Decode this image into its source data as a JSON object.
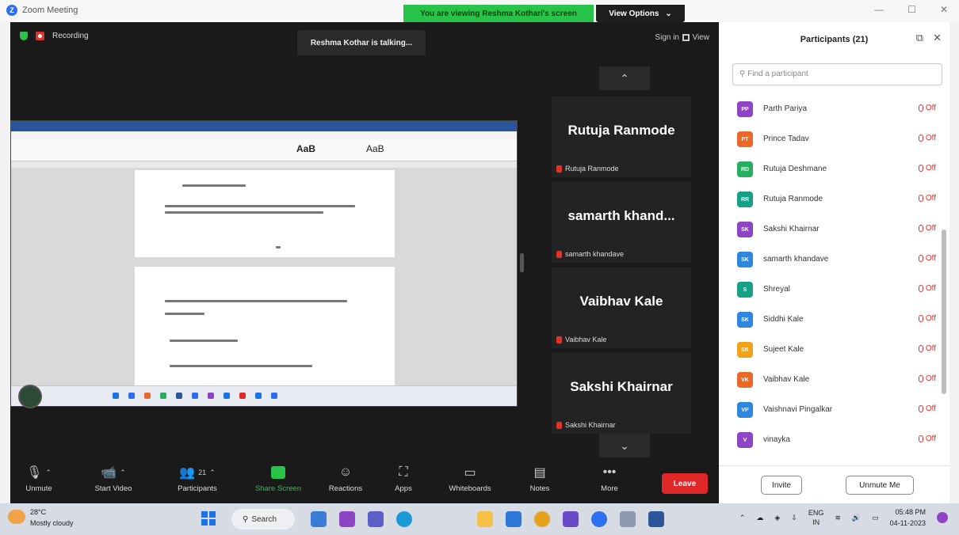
{
  "window": {
    "app_title": "Zoom Meeting",
    "viewing_banner": "You are viewing Reshma Kothari's screen",
    "view_options": "View Options",
    "view_options_caret": "⌄",
    "minimize": "—",
    "maximize": "☐",
    "close": "✕"
  },
  "meeting": {
    "recording": "Recording",
    "talking": "Reshma Kothar is talking...",
    "sign_in": "Sign in",
    "view": "View"
  },
  "shared_screen": {
    "ribbon_style1": "AaB",
    "ribbon_style2": "AaB"
  },
  "tiles": [
    {
      "name": "Rutuja Ranmode",
      "footer": "Rutuja Ranmode"
    },
    {
      "name": "samarth  khand...",
      "footer": "samarth khandave"
    },
    {
      "name": "Vaibhav Kale",
      "footer": "Vaibhav Kale"
    },
    {
      "name": "Sakshi Khairnar",
      "footer": "Sakshi Khairnar"
    }
  ],
  "scroll": {
    "up": "⌃",
    "down": "⌄"
  },
  "toolbar": {
    "unmute": "Unmute",
    "start_video": "Start Video",
    "participants": "Participants",
    "participants_count": "21",
    "share_screen": "Share Screen",
    "reactions": "Reactions",
    "apps": "Apps",
    "whiteboards": "Whiteboards",
    "notes": "Notes",
    "more": "More",
    "leave": "Leave"
  },
  "panel": {
    "title": "Participants (21)",
    "search_placeholder": "Find a participant",
    "invite": "Invite",
    "unmute_me": "Unmute Me",
    "participants": [
      {
        "initials": "PP",
        "name": "Parth Pariya",
        "status": "Off",
        "color": "#8e44c4"
      },
      {
        "initials": "PT",
        "name": "Prince Tadav",
        "status": "Off",
        "color": "#e8692a"
      },
      {
        "initials": "RD",
        "name": "Rutuja Deshmane",
        "status": "Off",
        "color": "#27ae60"
      },
      {
        "initials": "RR",
        "name": "Rutuja Ranmode",
        "status": "Off",
        "color": "#16a085"
      },
      {
        "initials": "SK",
        "name": "Sakshi Khairnar",
        "status": "Off",
        "color": "#8e44c4"
      },
      {
        "initials": "SK",
        "name": "samarth khandave",
        "status": "Off",
        "color": "#2e86de"
      },
      {
        "initials": "S",
        "name": "Shreyal",
        "status": "Off",
        "color": "#16a085"
      },
      {
        "initials": "SK",
        "name": "Siddhi Kale",
        "status": "Off",
        "color": "#2e86de"
      },
      {
        "initials": "SK",
        "name": "Sujeet Kale",
        "status": "Off",
        "color": "#f0a21a"
      },
      {
        "initials": "VK",
        "name": "Vaibhav Kale",
        "status": "Off",
        "color": "#e8692a"
      },
      {
        "initials": "VP",
        "name": "Vaishnavi Pingalkar",
        "status": "Off",
        "color": "#2e86de"
      },
      {
        "initials": "V",
        "name": "vinayka",
        "status": "Off",
        "color": "#8e44c4"
      }
    ]
  },
  "taskbar": {
    "temp": "28°C",
    "weather": "Mostly cloudy",
    "search": "Search",
    "lang1": "ENG",
    "lang2": "IN",
    "time": "05:48 PM",
    "date": "04-11-2023"
  }
}
